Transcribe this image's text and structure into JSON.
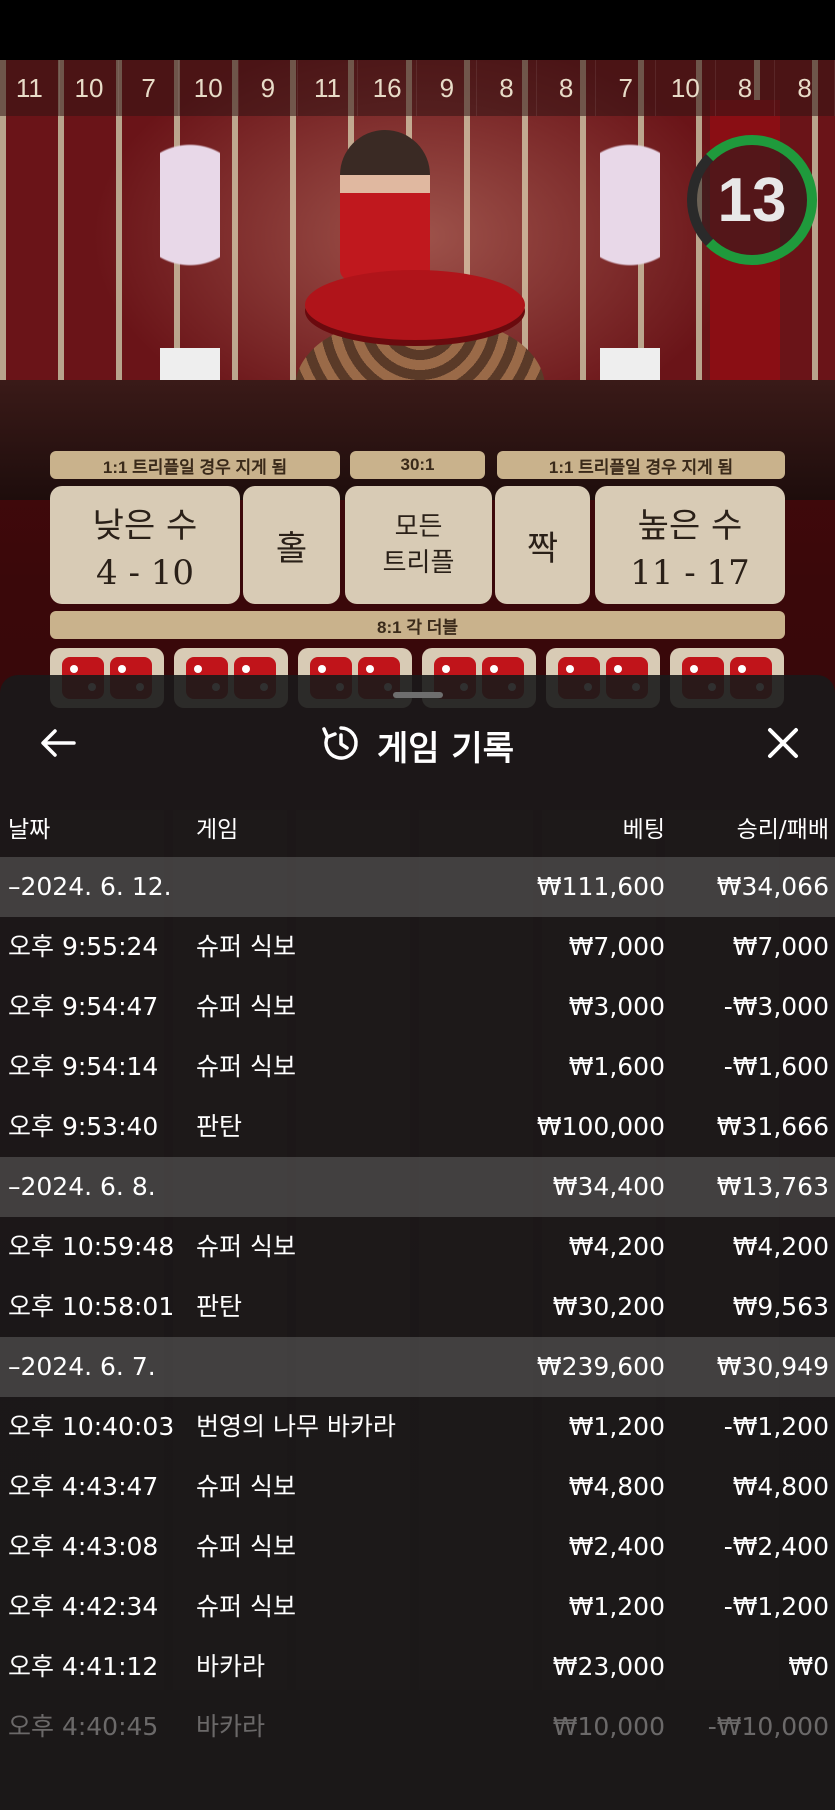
{
  "game_background": {
    "column_numbers": [
      "11",
      "10",
      "7",
      "10",
      "9",
      "11",
      "16",
      "9",
      "8",
      "8",
      "7",
      "10",
      "8",
      "8"
    ],
    "timer": "13",
    "payout_labels": {
      "left": "1:1 트리플일 경우 지게 됨",
      "center": "30:1",
      "right": "1:1 트리플일 경우 지게 됨",
      "doubles": "8:1 각 더블"
    },
    "bets": {
      "low_label": "낮은 수",
      "low_range": "4 - 10",
      "odd": "홀",
      "any_triple_line1": "모든",
      "any_triple_line2": "트리플",
      "even": "짝",
      "high_label": "높은 수",
      "high_range": "11 - 17"
    }
  },
  "sheet": {
    "title": "게임 기록",
    "icons": {
      "back": "arrow-left-icon",
      "history": "history-icon",
      "close": "close-icon"
    },
    "columns": {
      "date": "날짜",
      "game": "게임",
      "bet": "베팅",
      "win_loss": "승리/패배"
    },
    "rows": [
      {
        "type": "group",
        "date": "–2024. 6. 12.",
        "bet": "₩111,600",
        "result": "₩34,066"
      },
      {
        "type": "entry",
        "time": "오후 9:55:24",
        "game": "슈퍼 식보",
        "bet": "₩7,000",
        "result": "₩7,000"
      },
      {
        "type": "entry",
        "time": "오후 9:54:47",
        "game": "슈퍼 식보",
        "bet": "₩3,000",
        "result": "-₩3,000"
      },
      {
        "type": "entry",
        "time": "오후 9:54:14",
        "game": "슈퍼 식보",
        "bet": "₩1,600",
        "result": "-₩1,600"
      },
      {
        "type": "entry",
        "time": "오후 9:53:40",
        "game": "판탄",
        "bet": "₩100,000",
        "result": "₩31,666"
      },
      {
        "type": "group",
        "date": "–2024. 6. 8.",
        "bet": "₩34,400",
        "result": "₩13,763"
      },
      {
        "type": "entry",
        "time": "오후 10:59:48",
        "game": "슈퍼 식보",
        "bet": "₩4,200",
        "result": "₩4,200"
      },
      {
        "type": "entry",
        "time": "오후 10:58:01",
        "game": "판탄",
        "bet": "₩30,200",
        "result": "₩9,563"
      },
      {
        "type": "group",
        "date": "–2024. 6. 7.",
        "bet": "₩239,600",
        "result": "₩30,949"
      },
      {
        "type": "entry",
        "time": "오후 10:40:03",
        "game": "번영의 나무 바카라",
        "bet": "₩1,200",
        "result": "-₩1,200"
      },
      {
        "type": "entry",
        "time": "오후 4:43:47",
        "game": "슈퍼 식보",
        "bet": "₩4,800",
        "result": "₩4,800"
      },
      {
        "type": "entry",
        "time": "오후 4:43:08",
        "game": "슈퍼 식보",
        "bet": "₩2,400",
        "result": "-₩2,400"
      },
      {
        "type": "entry",
        "time": "오후 4:42:34",
        "game": "슈퍼 식보",
        "bet": "₩1,200",
        "result": "-₩1,200"
      },
      {
        "type": "entry",
        "time": "오후 4:41:12",
        "game": "바카라",
        "bet": "₩23,000",
        "result": "₩0"
      },
      {
        "type": "entry",
        "time": "오후 4:40:45",
        "game": "바카라",
        "bet": "₩10,000",
        "result": "-₩10,000",
        "faded": true
      }
    ]
  }
}
